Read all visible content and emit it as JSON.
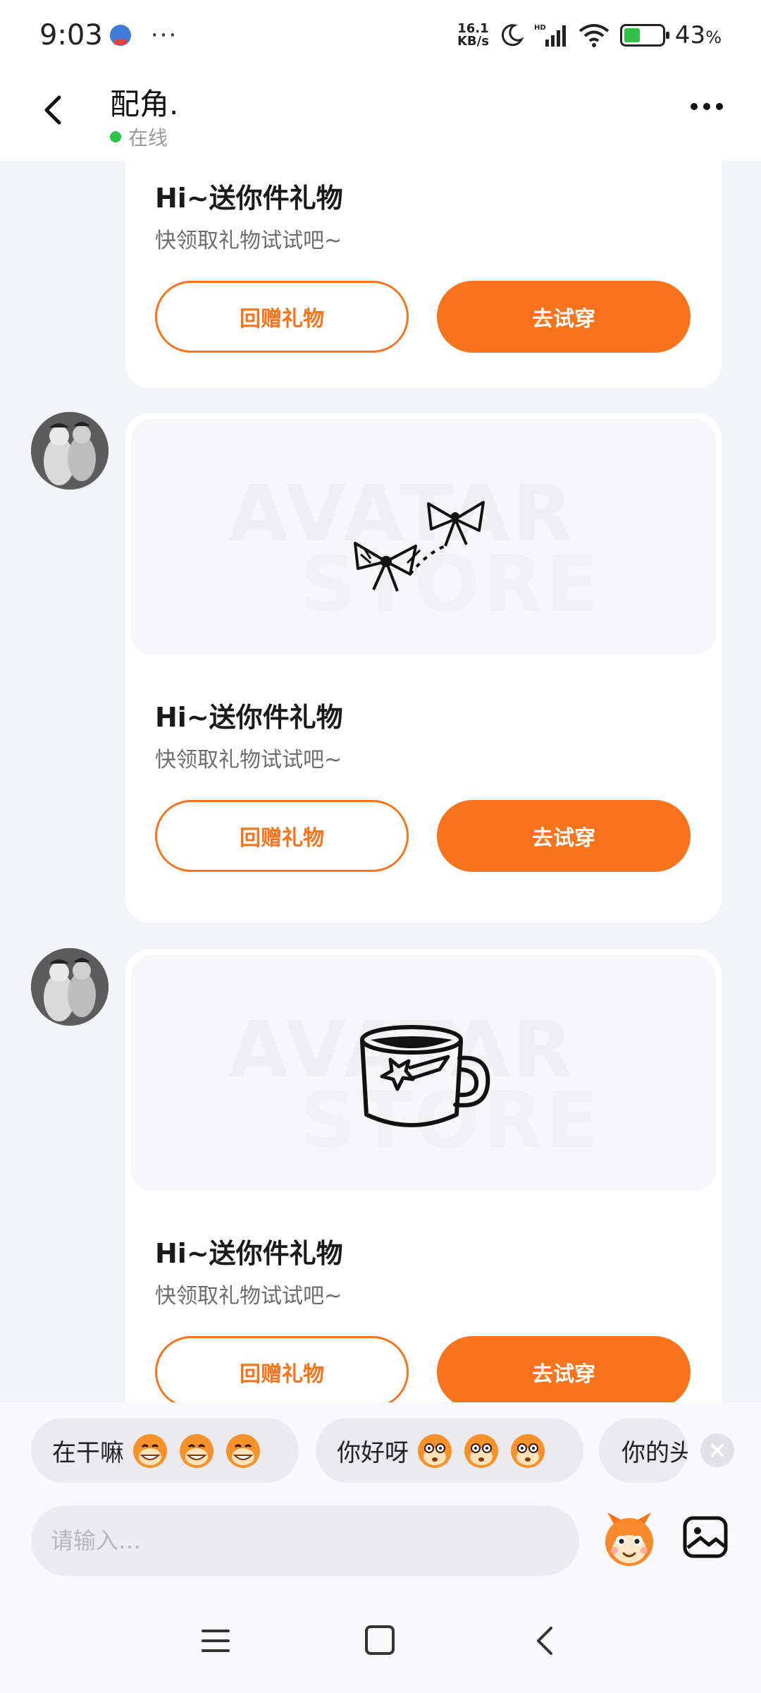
{
  "status_bar": {
    "time": "9:03",
    "dots": "···",
    "net_speed_value": "16.1",
    "net_speed_unit": "KB/s",
    "network_label": "HD",
    "battery_percent": "43",
    "battery_unit": "%",
    "battery_level": 0.43,
    "battery_color": "#2fc246"
  },
  "header": {
    "contact_name": "配角.",
    "status_text": "在线",
    "status_color": "#2bc44a",
    "back_icon": "chevron-left-icon",
    "more_icon": "more-horizontal-icon"
  },
  "messages": [
    {
      "title": "Hi~送你件礼物",
      "subtitle": "快领取礼物试试吧~",
      "return_gift_label": "回赠礼物",
      "try_on_label": "去试穿"
    },
    {
      "image_watermark_line1": "AVATAR",
      "image_watermark_line2": "STORE",
      "gift_icon": "bow-ties-icon",
      "title": "Hi~送你件礼物",
      "subtitle": "快领取礼物试试吧~",
      "return_gift_label": "回赠礼物",
      "try_on_label": "去试穿"
    },
    {
      "image_watermark_line1": "AVATAR",
      "image_watermark_line2": "STORE",
      "gift_icon": "star-mug-icon",
      "title": "Hi~送你件礼物",
      "subtitle": "快领取礼物试试吧~",
      "return_gift_label": "回赠礼物",
      "try_on_label": "去试穿"
    }
  ],
  "quick_replies": [
    {
      "text": "在干嘛",
      "emoji_icon": "grinning-monkey-icon"
    },
    {
      "text": "你好呀",
      "emoji_icon": "wide-eyed-monkey-icon"
    },
    {
      "text": "你的头"
    }
  ],
  "input": {
    "placeholder": "请输入…",
    "mascot_icon": "mascot-emoji-icon",
    "image_icon": "image-icon"
  },
  "accent_color": "#f7741c"
}
